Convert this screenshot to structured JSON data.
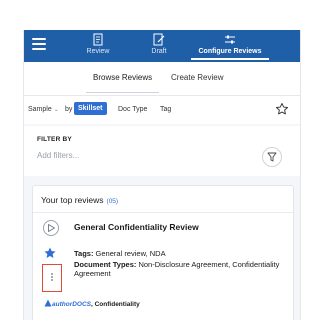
{
  "nav": {
    "items": [
      {
        "label": "Review",
        "icon": "document-icon"
      },
      {
        "label": "Draft",
        "icon": "draft-icon"
      },
      {
        "label": "Configure Reviews",
        "icon": "sliders-icon"
      }
    ],
    "active_index": 2
  },
  "subtabs": [
    "Browse Reviews",
    "Create Review"
  ],
  "toolbar": {
    "sample": "Sample",
    "by": "by",
    "skillset": "Skillset",
    "doc_type": "Doc Type",
    "tag": "Tag"
  },
  "filter": {
    "title": "FILTER BY",
    "placeholder": "Add filters..."
  },
  "reviews": {
    "title": "Your top reviews",
    "count": "(05)",
    "item": {
      "name": "General Confidentiality Review",
      "tags_label": "Tags:",
      "tags_value": "General review, NDA",
      "doc_types_label": "Document Types:",
      "doc_types_value": "Non-Disclosure Agreement, Confidentiality Agreement",
      "brand": "authorDOCS",
      "brand_suffix": ", Confidentiality"
    }
  },
  "colors": {
    "nav_bg": "#1f5fa8",
    "accent": "#2f6fd3",
    "highlight": "#e04a3a"
  }
}
